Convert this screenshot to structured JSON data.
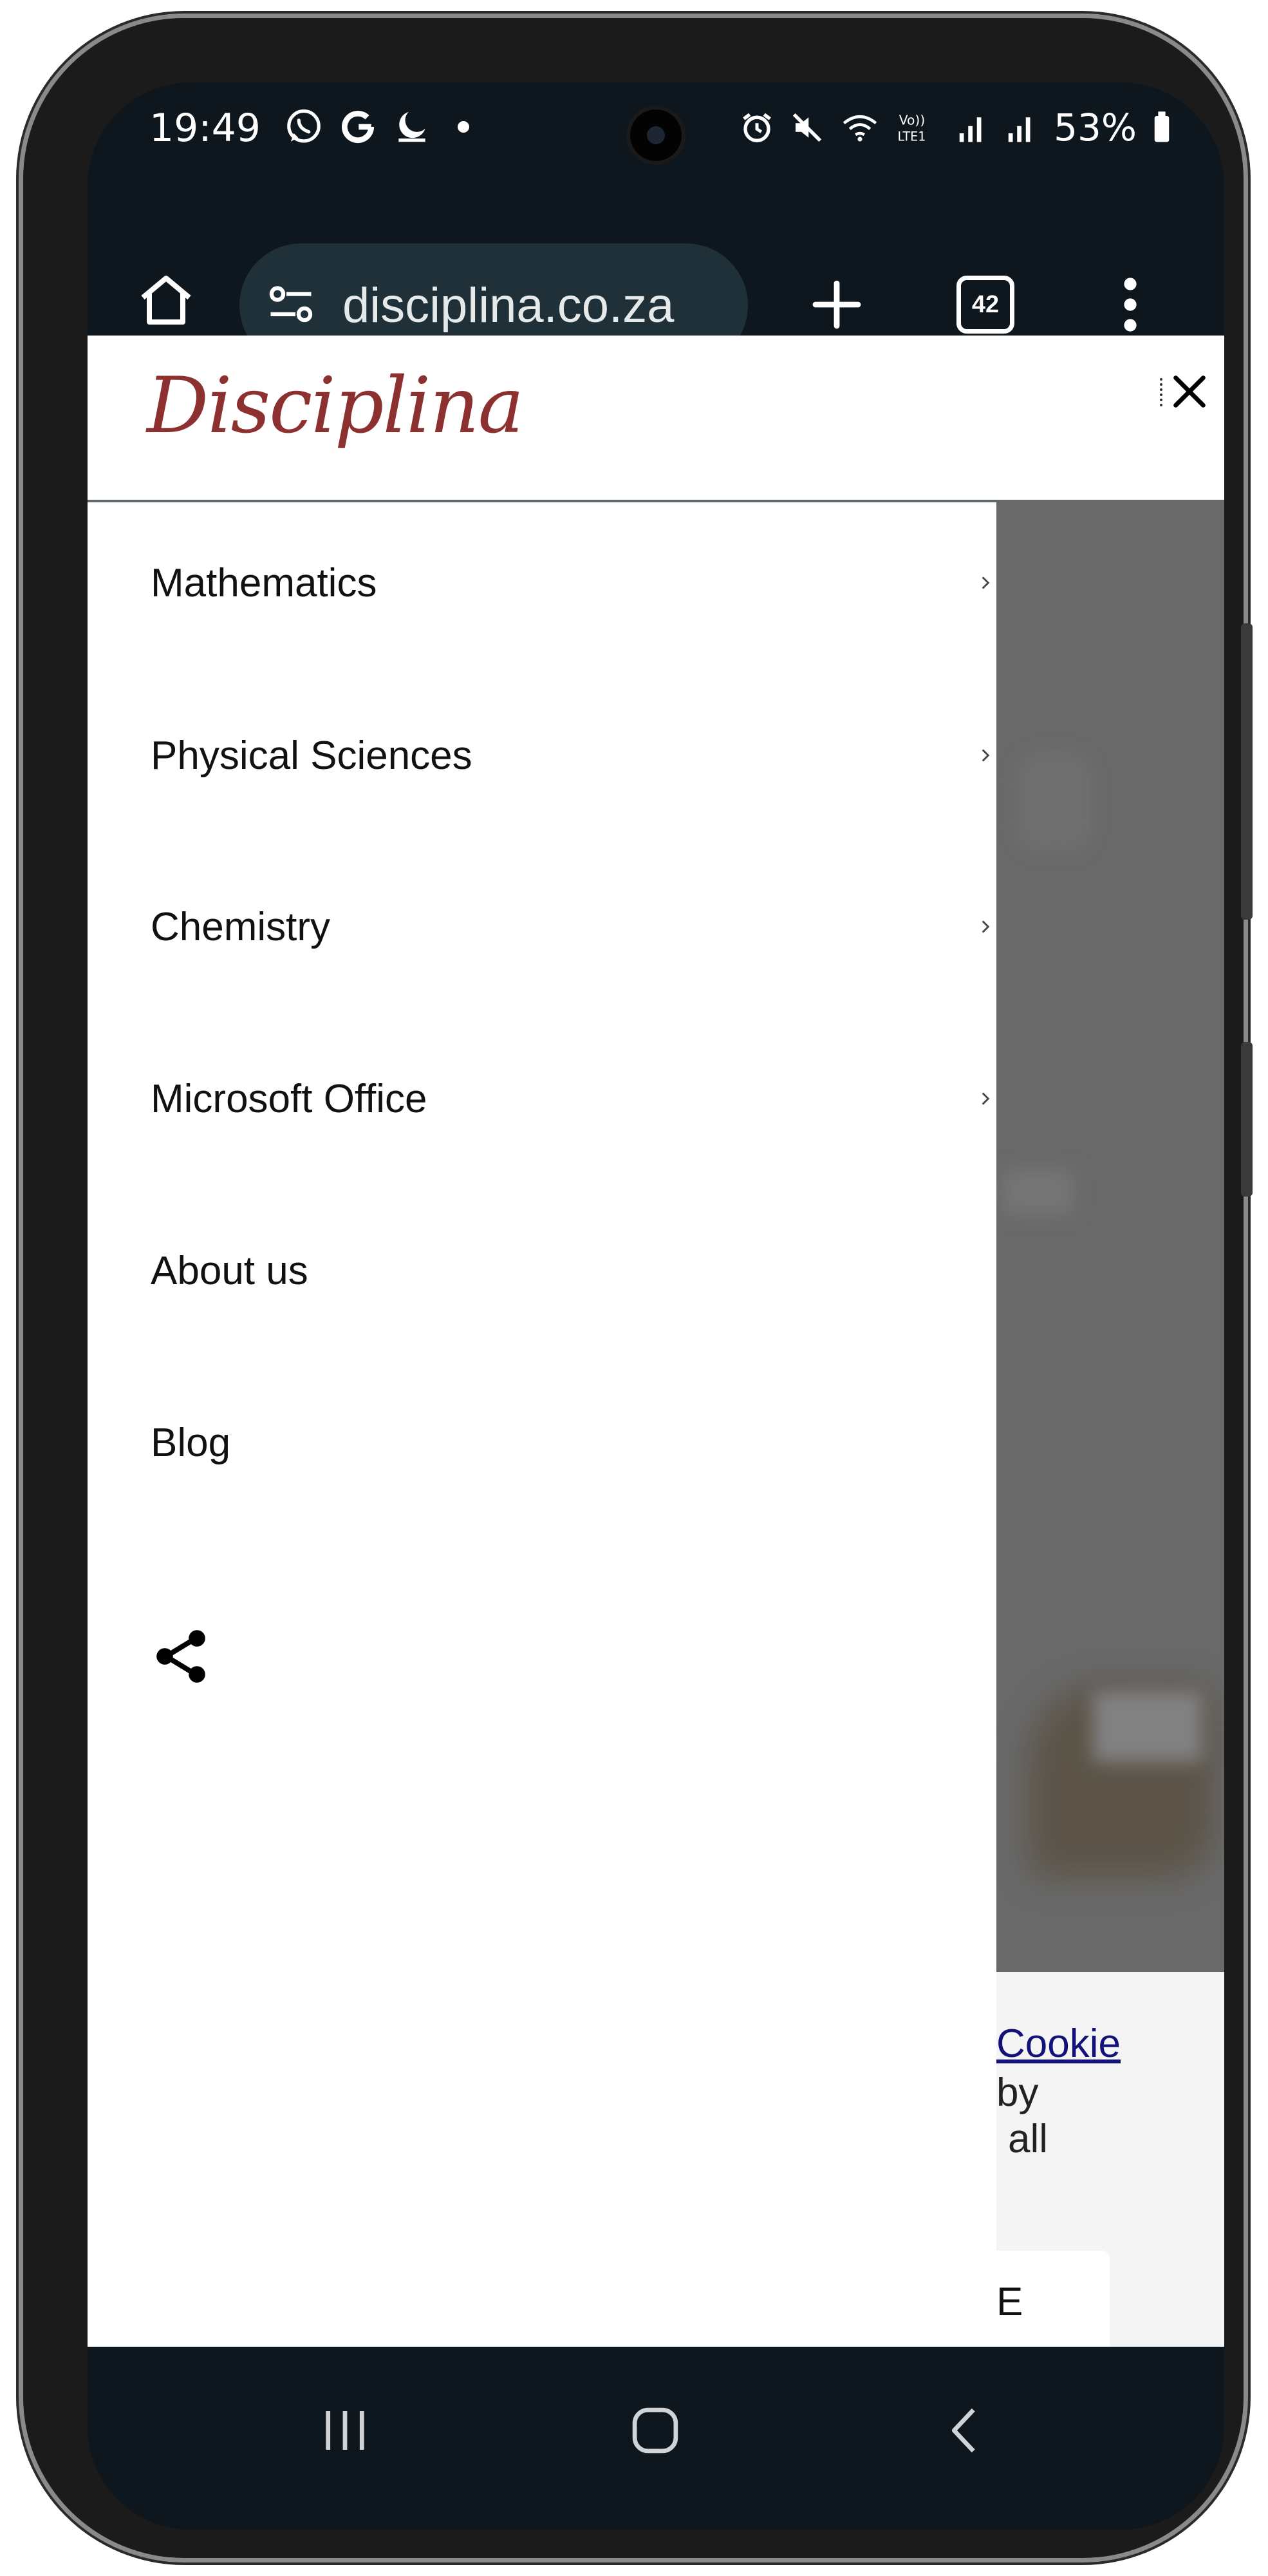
{
  "status_bar": {
    "time": "19:49",
    "battery": "53%",
    "left_icons": [
      "whatsapp-icon",
      "google-icon",
      "night-mode-icon",
      "dot-icon"
    ],
    "right_icons": [
      "alarm-icon",
      "mute-icon",
      "wifi-icon",
      "volte-icon",
      "signal-icon",
      "signal-icon",
      "battery-icon"
    ]
  },
  "browser": {
    "url": "disciplina.co.za",
    "tab_count": "42"
  },
  "site": {
    "logo_text": "Disciplina",
    "brand_color": "#8d3130"
  },
  "menu": {
    "items": [
      {
        "label": "Mathematics",
        "has_submenu": true
      },
      {
        "label": "Physical Sciences",
        "has_submenu": true
      },
      {
        "label": "Chemistry",
        "has_submenu": true
      },
      {
        "label": "Microsoft Office",
        "has_submenu": true
      },
      {
        "label": "About us",
        "has_submenu": false
      },
      {
        "label": "Blog",
        "has_submenu": false
      }
    ]
  },
  "cookie_banner": {
    "link_fragment": "Cookie",
    "line_1": "by",
    "line_2": "all",
    "button_fragment": "E"
  },
  "navigation_bar": {
    "icons": [
      "recent-apps-icon",
      "home-icon",
      "back-icon"
    ]
  }
}
